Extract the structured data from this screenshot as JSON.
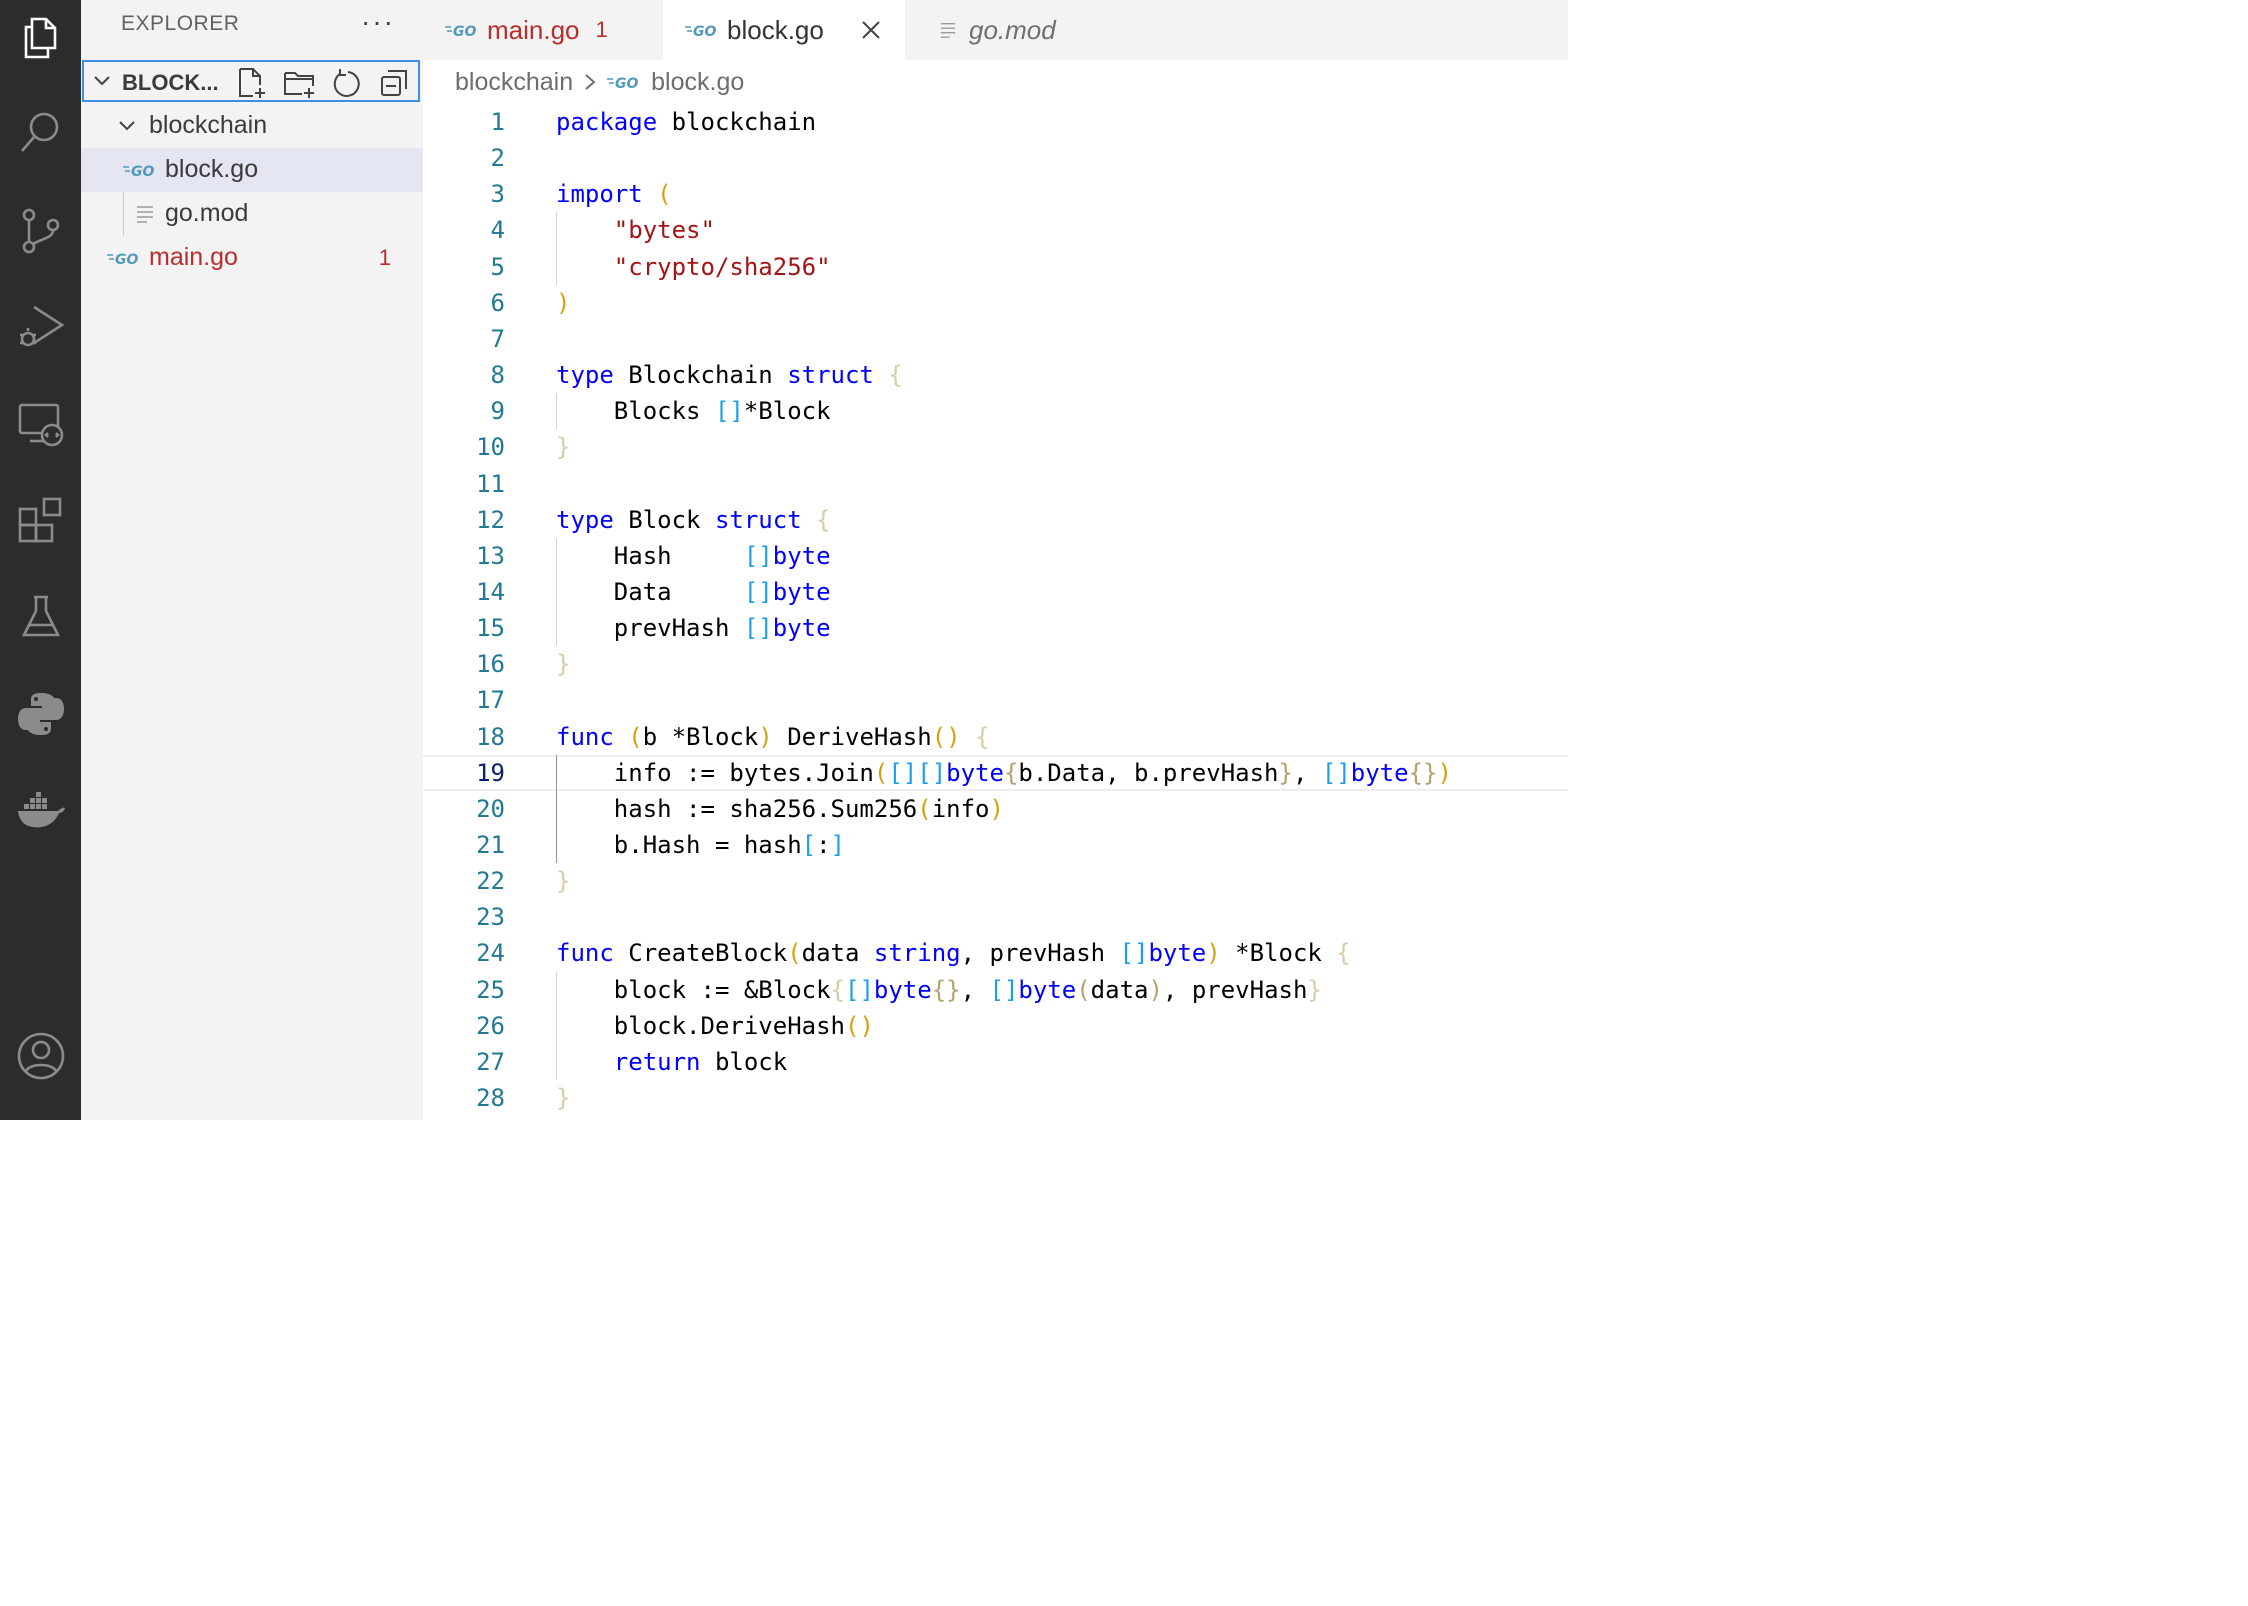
{
  "sidebar": {
    "title": "EXPLORER",
    "more": "···",
    "section_label": "BLOCK...",
    "tree": {
      "folder": "blockchain",
      "block_file": "block.go",
      "mod_file": "go.mod",
      "main_file": "main.go",
      "main_errors": "1"
    }
  },
  "tabs": [
    {
      "label": "main.go",
      "badge": "1"
    },
    {
      "label": "block.go"
    },
    {
      "label": "go.mod"
    }
  ],
  "breadcrumb": {
    "folder": "blockchain",
    "file": "block.go"
  },
  "editor": {
    "line_numbers": [
      "1",
      "2",
      "3",
      "4",
      "5",
      "6",
      "7",
      "8",
      "9",
      "10",
      "11",
      "12",
      "13",
      "14",
      "15",
      "16",
      "17",
      "18",
      "19",
      "20",
      "21",
      "22",
      "23",
      "24",
      "25",
      "26",
      "27",
      "28"
    ],
    "current_line": "19",
    "code_lines": [
      "package blockchain",
      "",
      "import (",
      "    \"bytes\"",
      "    \"crypto/sha256\"",
      ")",
      "",
      "type Blockchain struct {",
      "    Blocks []*Block",
      "}",
      "",
      "type Block struct {",
      "    Hash     []byte",
      "    Data     []byte",
      "    prevHash []byte",
      "}",
      "",
      "func (b *Block) DeriveHash() {",
      "    info := bytes.Join([][]byte{b.Data, b.prevHash}, []byte{})",
      "    hash := sha256.Sum256(info)",
      "    b.Hash = hash[:]",
      "}",
      "",
      "func CreateBlock(data string, prevHash []byte) *Block {",
      "    block := &Block{[]byte{}, []byte(data), prevHash}",
      "    block.DeriveHash()",
      "    return block",
      "}"
    ]
  },
  "colors": {
    "activity_bar": "#2c2c2c",
    "sidebar": "#f3f3f3",
    "focus_border": "#3c8ee6",
    "error": "#b92d2d",
    "keyword": "#0000ff",
    "string": "#a31515",
    "line_number": "#237893"
  }
}
